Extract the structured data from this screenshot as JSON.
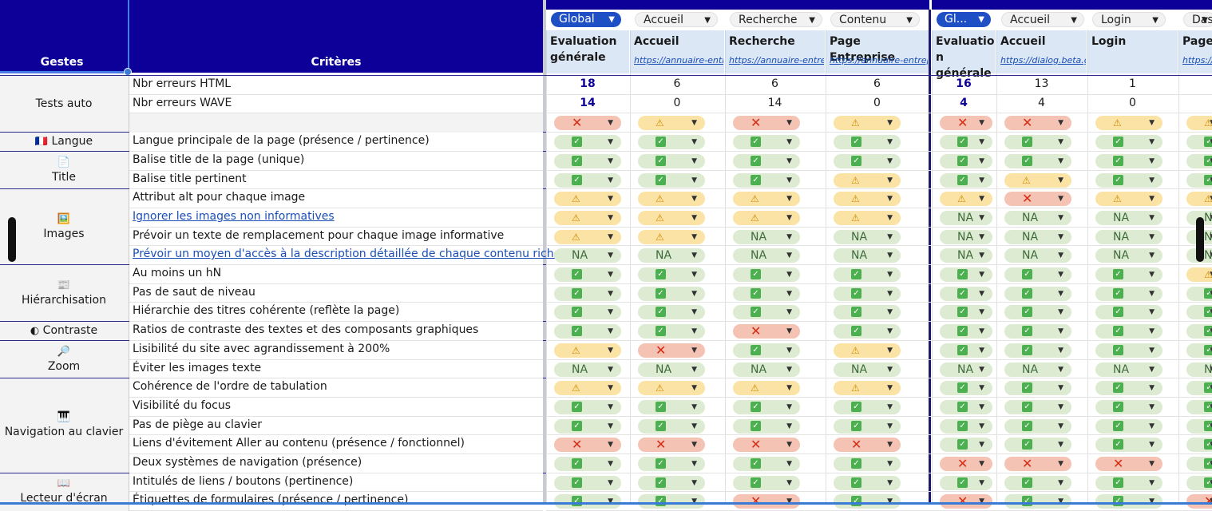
{
  "header": {
    "gestes_label": "Gestes",
    "criteres_label": "Critères"
  },
  "columns": [
    {
      "selector": "Global",
      "title": "Evaluation générale",
      "url": "",
      "active": true
    },
    {
      "selector": "Accueil",
      "title": "Accueil",
      "url": "https://annuaire-entr",
      "active": false
    },
    {
      "selector": "Recherche",
      "title": "Recherche",
      "url": "https://annuaire-entre",
      "active": false
    },
    {
      "selector": "Contenu",
      "title": "Page Entreprise",
      "url": "https://annuaire-entrep",
      "active": false
    },
    {
      "selector": "Gl...",
      "title": "Evaluatio n générale",
      "url": "",
      "active": true
    },
    {
      "selector": "Accueil",
      "title": "Accueil",
      "url": "https://dialog.beta.g",
      "active": false
    },
    {
      "selector": "Login",
      "title": "Login",
      "url": "",
      "active": false
    },
    {
      "selector": "Das",
      "title": "Page d",
      "url": "https://",
      "active": false
    }
  ],
  "categories": [
    {
      "icon": "",
      "label": "Tests auto"
    },
    {
      "icon": "🇫🇷",
      "label": "Langue"
    },
    {
      "icon": "📄",
      "label": "Title"
    },
    {
      "icon": "🖼️",
      "label": "Images"
    },
    {
      "icon": "📰",
      "label": "Hiérarchisation"
    },
    {
      "icon": "◐",
      "label": "Contraste"
    },
    {
      "icon": "🔎",
      "label": "Zoom"
    },
    {
      "icon": "🎹",
      "label": "Navigation au clavier"
    },
    {
      "icon": "📖",
      "label": "Lecteur d'écran"
    }
  ],
  "rows": [
    {
      "criterion": "Nbr erreurs HTML",
      "link": false,
      "type": "num",
      "values": [
        "18",
        "6",
        "6",
        "6",
        "16",
        "13",
        "1",
        ""
      ]
    },
    {
      "criterion": "Nbr erreurs WAVE",
      "link": false,
      "type": "num",
      "values": [
        "14",
        "0",
        "14",
        "0",
        "4",
        "4",
        "0",
        ""
      ]
    },
    {
      "criterion": "",
      "link": false,
      "type": "badge",
      "values": [
        "ko",
        "warn",
        "ko",
        "warn",
        "ko",
        "ko",
        "warn",
        "warn"
      ]
    },
    {
      "criterion": "Langue principale de la page (présence / pertinence)",
      "link": false,
      "type": "badge",
      "values": [
        "ok",
        "ok",
        "ok",
        "ok",
        "ok",
        "ok",
        "ok",
        "ok"
      ]
    },
    {
      "criterion": "Balise title de la page (unique)",
      "link": false,
      "type": "badge",
      "values": [
        "ok",
        "ok",
        "ok",
        "ok",
        "ok",
        "ok",
        "ok",
        "ok"
      ]
    },
    {
      "criterion": "Balise title pertinent",
      "link": false,
      "type": "badge",
      "values": [
        "ok",
        "ok",
        "ok",
        "warn",
        "ok",
        "warn",
        "ok",
        "ok"
      ]
    },
    {
      "criterion": "Attribut alt pour chaque image",
      "link": false,
      "type": "badge",
      "values": [
        "warn",
        "warn",
        "warn",
        "warn",
        "warn",
        "ko",
        "warn",
        "warn"
      ]
    },
    {
      "criterion": "Ignorer les images non informatives",
      "link": true,
      "type": "badge",
      "values": [
        "warn",
        "warn",
        "warn",
        "warn",
        "na",
        "na",
        "na",
        "na"
      ]
    },
    {
      "criterion": "Prévoir un texte de remplacement pour chaque image informative",
      "link": false,
      "type": "badge",
      "values": [
        "warn",
        "warn",
        "na",
        "na",
        "na",
        "na",
        "na",
        "na"
      ]
    },
    {
      "criterion": "Prévoir un moyen d'accès à la description détaillée de chaque contenu riche",
      "link": true,
      "type": "badge",
      "values": [
        "na",
        "na",
        "na",
        "na",
        "na",
        "na",
        "na",
        "na"
      ]
    },
    {
      "criterion": "Au moins un hN",
      "link": false,
      "type": "badge",
      "values": [
        "ok",
        "ok",
        "ok",
        "ok",
        "ok",
        "ok",
        "ok",
        "warn"
      ]
    },
    {
      "criterion": "Pas de saut de niveau",
      "link": false,
      "type": "badge",
      "values": [
        "ok",
        "ok",
        "ok",
        "ok",
        "ok",
        "ok",
        "ok",
        "ok"
      ]
    },
    {
      "criterion": "Hiérarchie des titres cohérente (reflète la page)",
      "link": false,
      "type": "badge",
      "values": [
        "ok",
        "ok",
        "ok",
        "ok",
        "ok",
        "ok",
        "ok",
        "ok"
      ]
    },
    {
      "criterion": "Ratios de contraste des textes et des composants graphiques",
      "link": false,
      "type": "badge",
      "values": [
        "ok",
        "ok",
        "ko",
        "ok",
        "ok",
        "ok",
        "ok",
        "ok"
      ]
    },
    {
      "criterion": "Lisibilité du site avec agrandissement à 200%",
      "link": false,
      "type": "badge",
      "values": [
        "warn",
        "ko",
        "ok",
        "warn",
        "ok",
        "ok",
        "ok",
        "ok"
      ]
    },
    {
      "criterion": "Éviter les images texte",
      "link": false,
      "type": "badge",
      "values": [
        "na",
        "na",
        "na",
        "na",
        "na",
        "na",
        "na",
        "na"
      ]
    },
    {
      "criterion": "Cohérence de l'ordre de tabulation",
      "link": false,
      "type": "badge",
      "values": [
        "warn",
        "warn",
        "warn",
        "warn",
        "ok",
        "ok",
        "ok",
        "ok"
      ]
    },
    {
      "criterion": "Visibilité du focus",
      "link": false,
      "type": "badge",
      "values": [
        "ok",
        "ok",
        "ok",
        "ok",
        "ok",
        "ok",
        "ok",
        "ok"
      ]
    },
    {
      "criterion": "Pas de piège au clavier",
      "link": false,
      "type": "badge",
      "values": [
        "ok",
        "ok",
        "ok",
        "ok",
        "ok",
        "ok",
        "ok",
        "ok"
      ]
    },
    {
      "criterion": "Liens d'évitement Aller au contenu (présence / fonctionnel)",
      "link": false,
      "type": "badge",
      "values": [
        "ko",
        "ko",
        "ko",
        "ko",
        "ok",
        "ok",
        "ok",
        "ok"
      ]
    },
    {
      "criterion": "Deux systèmes de navigation (présence)",
      "link": false,
      "type": "badge",
      "values": [
        "ok",
        "ok",
        "ok",
        "ok",
        "ko",
        "ko",
        "ko",
        "ok"
      ]
    },
    {
      "criterion": "Intitulés de liens / boutons (pertinence)",
      "link": false,
      "type": "badge",
      "values": [
        "ok",
        "ok",
        "ok",
        "ok",
        "ok",
        "ok",
        "ok",
        "ok"
      ]
    },
    {
      "criterion": "Étiquettes de formulaires (présence / pertinence)",
      "link": false,
      "type": "badge",
      "values": [
        "ok",
        "ok",
        "ko",
        "ok",
        "ko",
        "ok",
        "ok",
        "ko"
      ]
    }
  ],
  "status_text": {
    "ok": "✓",
    "warn": "⚠",
    "ko": "✕",
    "na": "NA"
  },
  "colors": {
    "header_bg": "#0d0099",
    "ok": "#dcebd1",
    "warn": "#fbe3a5",
    "ko": "#f5c3b4",
    "link": "#1a4fb8"
  }
}
